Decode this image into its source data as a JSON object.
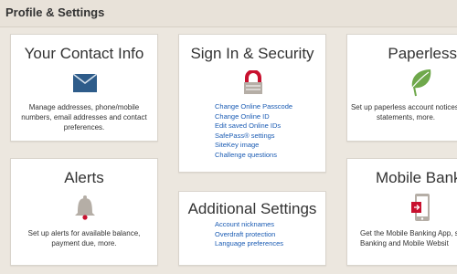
{
  "header": {
    "title": "Profile & Settings"
  },
  "cards": {
    "contact": {
      "title": "Your Contact Info",
      "description": "Manage addresses, phone/mobile numbers, email addresses and contact preferences.",
      "icon": "envelope-icon"
    },
    "signin": {
      "title": "Sign In & Security",
      "icon": "padlock-icon",
      "links": [
        "Change Online Passcode",
        "Change Online ID",
        "Edit saved Online IDs",
        "SafePass® settings",
        "SiteKey image",
        "Challenge questions"
      ]
    },
    "paperless": {
      "title": "Paperless",
      "description": "Set up paperless account notices, statements, more.",
      "icon": "leaf-icon"
    },
    "alerts": {
      "title": "Alerts",
      "description": "Set up alerts for available balance, payment due, more.",
      "icon": "bell-icon"
    },
    "additional": {
      "title": "Additional Settings",
      "links": [
        "Account nicknames",
        "Overdraft protection",
        "Language preferences"
      ]
    },
    "mobile": {
      "title": "Mobile Banking",
      "description": "Get the Mobile Banking App, set Banking and Mobile Websit",
      "icon": "mobile-phone-icon"
    }
  },
  "colors": {
    "background": "#ece7df",
    "link": "#1a5bb3",
    "accent_red": "#c8102e",
    "icon_blue": "#2e5c8a",
    "icon_green": "#6fa84b",
    "icon_gray": "#b5aea6"
  }
}
